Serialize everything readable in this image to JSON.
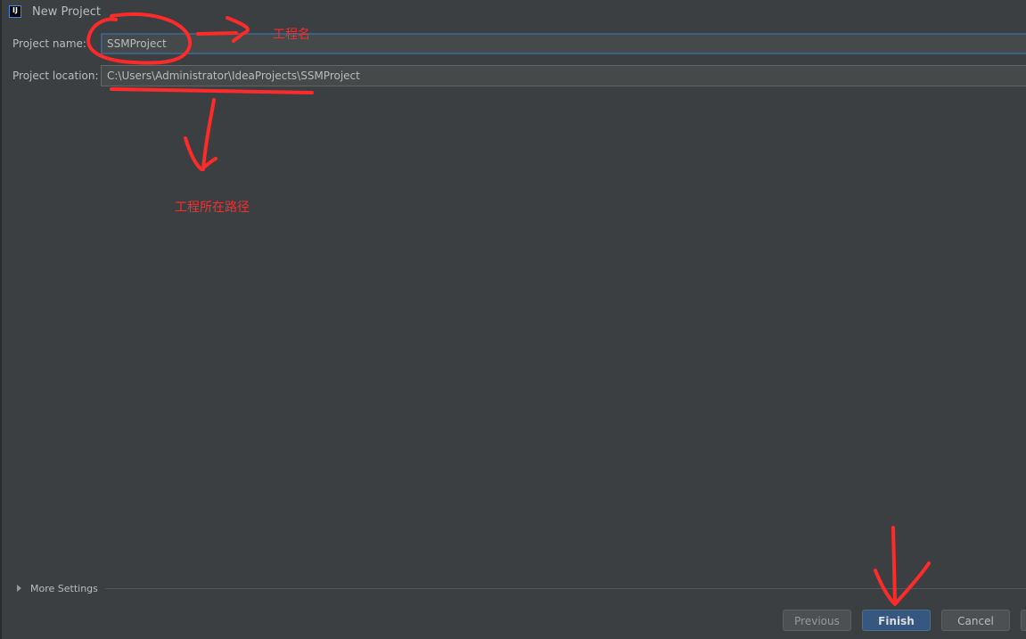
{
  "window": {
    "title": "New Project",
    "icon": "intellij-idea-icon"
  },
  "form": {
    "project_name_label": "Project name:",
    "project_name_value": "SSMProject",
    "project_location_label": "Project location:",
    "project_location_value": "C:\\Users\\Administrator\\IdeaProjects\\SSMProject"
  },
  "more_settings": {
    "label": "More Settings",
    "icon": "triangle-right-icon"
  },
  "buttons": {
    "previous": "Previous",
    "finish": "Finish",
    "cancel": "Cancel"
  },
  "annotations": {
    "name_note": "工程名",
    "location_note": "工程所在路径",
    "color": "#ff2a2a"
  },
  "colors": {
    "background": "#3c3f41",
    "accent": "#365880",
    "focus_border": "#3d6185"
  }
}
